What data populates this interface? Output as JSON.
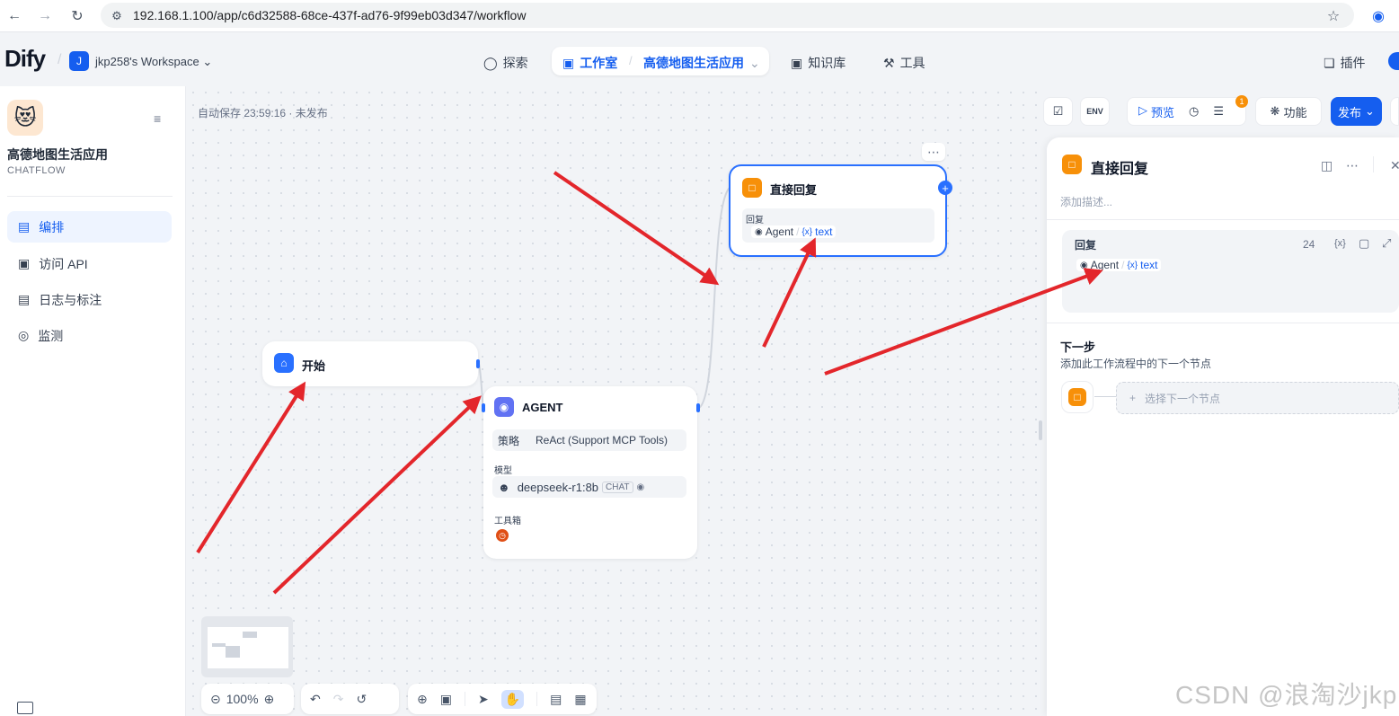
{
  "browser": {
    "url": "192.168.1.100/app/c6d32588-68ce-437f-ad76-9f99eb03d347/workflow"
  },
  "header": {
    "logo": "Dify",
    "workspace_initial": "J",
    "workspace_name": "jkp258's Workspace",
    "nav_explore": "探索",
    "nav_studio": "工作室",
    "nav_current_app": "高德地图生活应用",
    "nav_knowledge": "知识库",
    "nav_tools": "工具",
    "plugins": "插件"
  },
  "sidebar": {
    "app_title": "高德地图生活应用",
    "app_type": "CHATFLOW",
    "items": [
      {
        "label": "编排"
      },
      {
        "label": "访问 API"
      },
      {
        "label": "日志与标注"
      },
      {
        "label": "监测"
      }
    ]
  },
  "canvas": {
    "autosave": "自动保存 23:59:16 · 未发布",
    "zoom": "100%",
    "start_node": {
      "title": "开始"
    },
    "agent_node": {
      "title": "AGENT",
      "strategy_label": "策略",
      "strategy_value": "ReAct (Support MCP Tools)",
      "model_label": "模型",
      "model_value": "deepseek-r1:8b",
      "model_badge": "CHAT",
      "tools_label": "工具箱"
    },
    "answer_node": {
      "title": "直接回复",
      "reply_label": "回复",
      "var_source": "Agent",
      "var_sep": "/",
      "var_name": "text"
    }
  },
  "toolbar": {
    "preview": "预览",
    "badge_count": "1",
    "features": "功能",
    "publish": "发布"
  },
  "panel": {
    "title": "直接回复",
    "description_placeholder": "添加描述...",
    "reply_label": "回复",
    "char_count": "24",
    "var_token": "{x}",
    "var_source": "Agent",
    "var_sep": "/",
    "var_name": "text",
    "next_step_title": "下一步",
    "next_step_desc": "添加此工作流程中的下一个节点",
    "select_next": "选择下一个节点"
  },
  "watermark": "CSDN @浪淘沙jkp",
  "colors": {
    "brand": "#155eef",
    "answer_orange": "#f79009",
    "arrow_red": "#e3262b"
  }
}
